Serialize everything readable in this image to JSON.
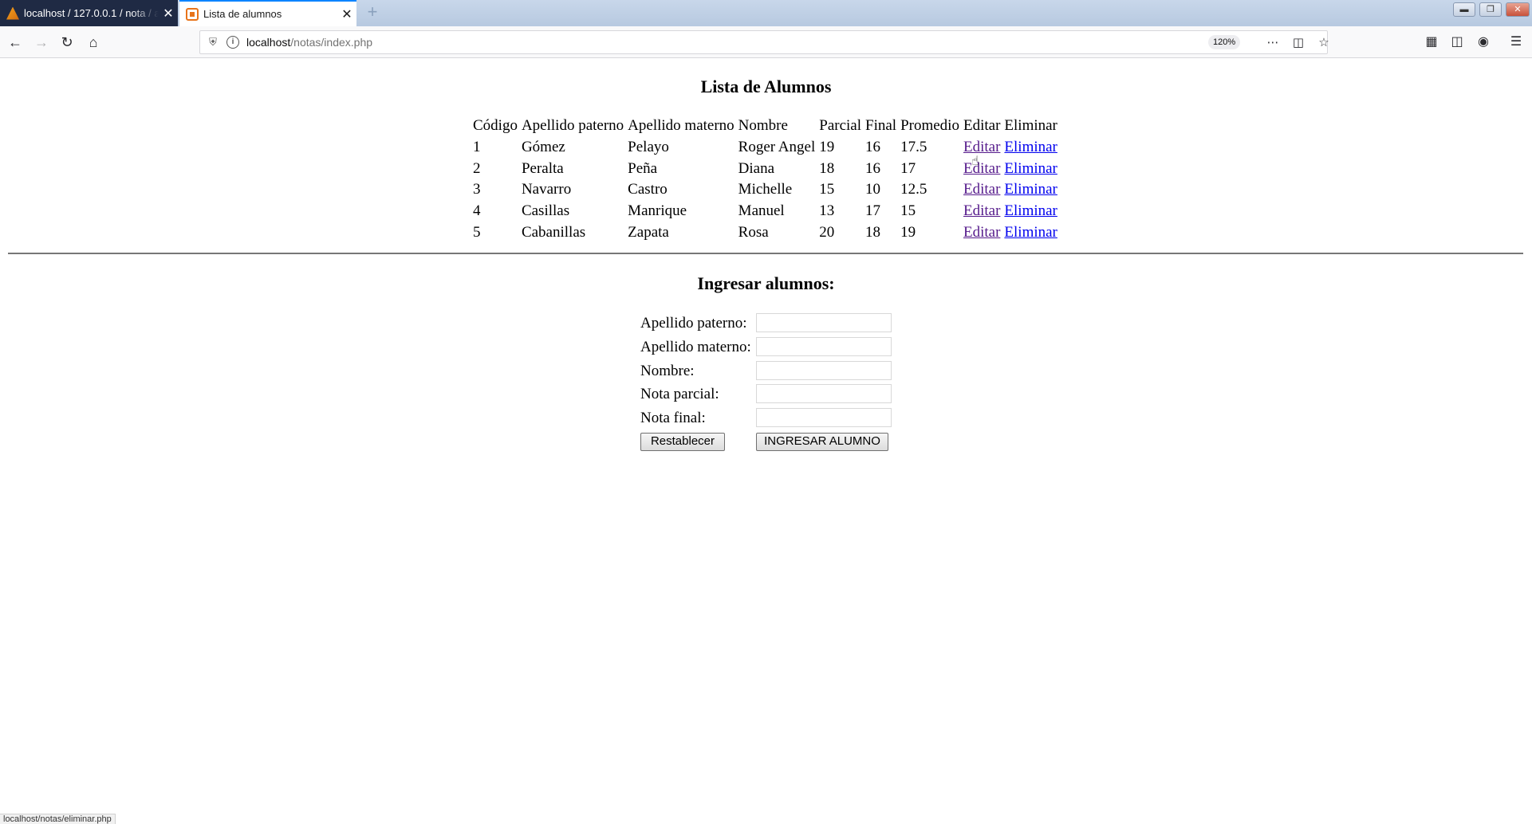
{
  "browser": {
    "tabs": [
      {
        "title": "localhost / 127.0.0.1 / nota / al",
        "close": "✕",
        "icon": "phpmyadmin-favicon"
      },
      {
        "title": "Lista de alumnos",
        "close": "✕",
        "icon": "page-favicon"
      }
    ],
    "new_tab": "+",
    "url_host": "localhost",
    "url_path": "/notas/index.php",
    "zoom": "120%",
    "status_url": "localhost/notas/eliminar.php",
    "window_controls": [
      "minimize-icon",
      "restore-icon",
      "close-icon"
    ],
    "toolbar_icons": [
      "library-icon",
      "sidebar-icon",
      "account-icon",
      "menu-icon"
    ]
  },
  "page": {
    "list_heading": "Lista de Alumnos",
    "table": {
      "headers": [
        "Código",
        "Apellido paterno",
        "Apellido materno",
        "Nombre",
        "Parcial",
        "Final",
        "Promedio",
        "Editar",
        "Eliminar"
      ],
      "rows": [
        {
          "codigo": "1",
          "ap_paterno": "Gómez",
          "ap_materno": "Pelayo",
          "nombre": "Roger Angel",
          "parcial": "19",
          "final": "16",
          "promedio": "17.5",
          "editar": "Editar",
          "eliminar": "Eliminar"
        },
        {
          "codigo": "2",
          "ap_paterno": "Peralta",
          "ap_materno": "Peña",
          "nombre": "Diana",
          "parcial": "18",
          "final": "16",
          "promedio": "17",
          "editar": "Editar",
          "eliminar": "Eliminar"
        },
        {
          "codigo": "3",
          "ap_paterno": "Navarro",
          "ap_materno": "Castro",
          "nombre": "Michelle",
          "parcial": "15",
          "final": "10",
          "promedio": "12.5",
          "editar": "Editar",
          "eliminar": "Eliminar"
        },
        {
          "codigo": "4",
          "ap_paterno": "Casillas",
          "ap_materno": "Manrique",
          "nombre": "Manuel",
          "parcial": "13",
          "final": "17",
          "promedio": "15",
          "editar": "Editar",
          "eliminar": "Eliminar"
        },
        {
          "codigo": "5",
          "ap_paterno": "Cabanillas",
          "ap_materno": "Zapata",
          "nombre": "Rosa",
          "parcial": "20",
          "final": "18",
          "promedio": "19",
          "editar": "Editar",
          "eliminar": "Eliminar"
        }
      ]
    },
    "form_heading": "Ingresar alumnos:",
    "form": {
      "ap_paterno_label": "Apellido paterno:",
      "ap_materno_label": "Apellido materno:",
      "nombre_label": "Nombre:",
      "parcial_label": "Nota parcial:",
      "final_label": "Nota final:",
      "reset_label": "Restablecer",
      "submit_label": "INGRESAR ALUMNO",
      "ap_paterno_value": "",
      "ap_materno_value": "",
      "nombre_value": "",
      "parcial_value": "",
      "final_value": ""
    }
  }
}
